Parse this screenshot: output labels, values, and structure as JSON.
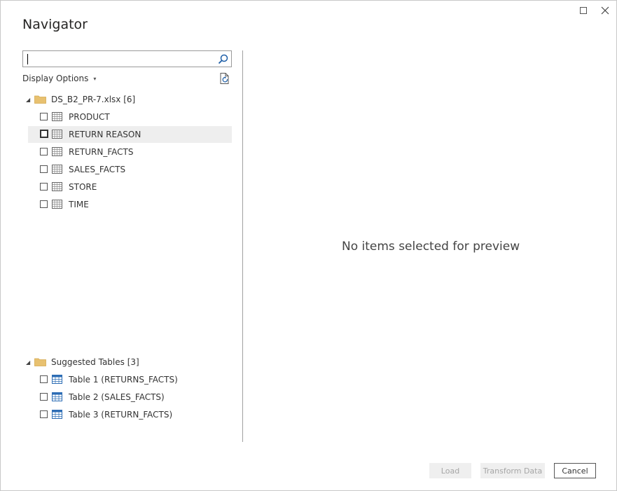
{
  "window": {
    "title": "Navigator",
    "maximize_icon": "maximize-icon",
    "close_icon": "close-icon"
  },
  "search": {
    "value": "",
    "placeholder": "",
    "icon": "search-icon"
  },
  "display_options": {
    "label": "Display Options",
    "chevron": "▾"
  },
  "tree": {
    "source": {
      "label": "DS_B2_PR-7.xlsx [6]",
      "expander": "◢",
      "items": [
        {
          "label": "PRODUCT"
        },
        {
          "label": "RETURN REASON"
        },
        {
          "label": "RETURN_FACTS"
        },
        {
          "label": "SALES_FACTS"
        },
        {
          "label": "STORE"
        },
        {
          "label": "TIME"
        }
      ]
    },
    "suggested": {
      "label": "Suggested Tables [3]",
      "expander": "◢",
      "items": [
        {
          "label": "Table 1 (RETURNS_FACTS)"
        },
        {
          "label": "Table 2 (SALES_FACTS)"
        },
        {
          "label": "Table 3 (RETURN_FACTS)"
        }
      ]
    }
  },
  "preview": {
    "empty_message": "No items selected for preview"
  },
  "footer": {
    "load_label": "Load",
    "transform_label": "Transform Data",
    "cancel_label": "Cancel"
  },
  "colors": {
    "folder": "#e8c170",
    "table_icon_blue": "#2d6db5",
    "disabled_button_bg": "#efefef",
    "hover_row_bg": "#eeeeee"
  }
}
